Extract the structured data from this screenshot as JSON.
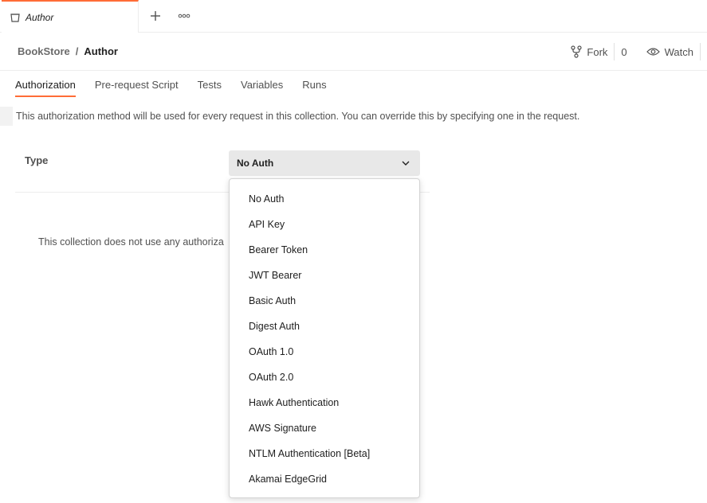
{
  "tab": {
    "label": "Author",
    "icon": "collection-icon"
  },
  "header": {
    "breadcrumb_parent": "BookStore",
    "breadcrumb_sep": "/",
    "breadcrumb_current": "Author",
    "fork_label": "Fork",
    "fork_count": "0",
    "watch_label": "Watch"
  },
  "subtabs": [
    "Authorization",
    "Pre-request Script",
    "Tests",
    "Variables",
    "Runs"
  ],
  "help_text": "This authorization method will be used for every request in this collection. You can override this by specifying one in the request.",
  "type": {
    "label": "Type",
    "selected": "No Auth"
  },
  "info_text": "This collection does not use any authoriza",
  "dropdown_options": [
    "No Auth",
    "API Key",
    "Bearer Token",
    "JWT Bearer",
    "Basic Auth",
    "Digest Auth",
    "OAuth 1.0",
    "OAuth 2.0",
    "Hawk Authentication",
    "AWS Signature",
    "NTLM Authentication [Beta]",
    "Akamai EdgeGrid"
  ],
  "colors": {
    "accent": "#ff6c37",
    "select_bg": "#e8e8e8"
  }
}
